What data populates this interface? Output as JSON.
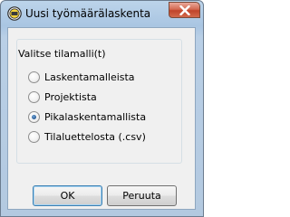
{
  "window": {
    "title": "Uusi työmäärälaskenta"
  },
  "group": {
    "title": "Valitse tilamalli(t)"
  },
  "options": [
    {
      "label": "Laskentamalleista",
      "selected": false
    },
    {
      "label": "Projektista",
      "selected": false
    },
    {
      "label": "Pikalaskentamallista",
      "selected": true
    },
    {
      "label": "Tilaluettelosta (.csv)",
      "selected": false
    }
  ],
  "buttons": {
    "ok_label": "OK",
    "cancel_label": "Peruuta"
  },
  "colors": {
    "titlebar": "#b3c9e0",
    "client_bg": "#f0f0f0",
    "close_button": "#c0442a",
    "radio_selected": "#1e4f8a",
    "default_button_border": "#3c7fb1"
  },
  "icons": {
    "app": "app-logo-icon",
    "close": "close-icon"
  }
}
